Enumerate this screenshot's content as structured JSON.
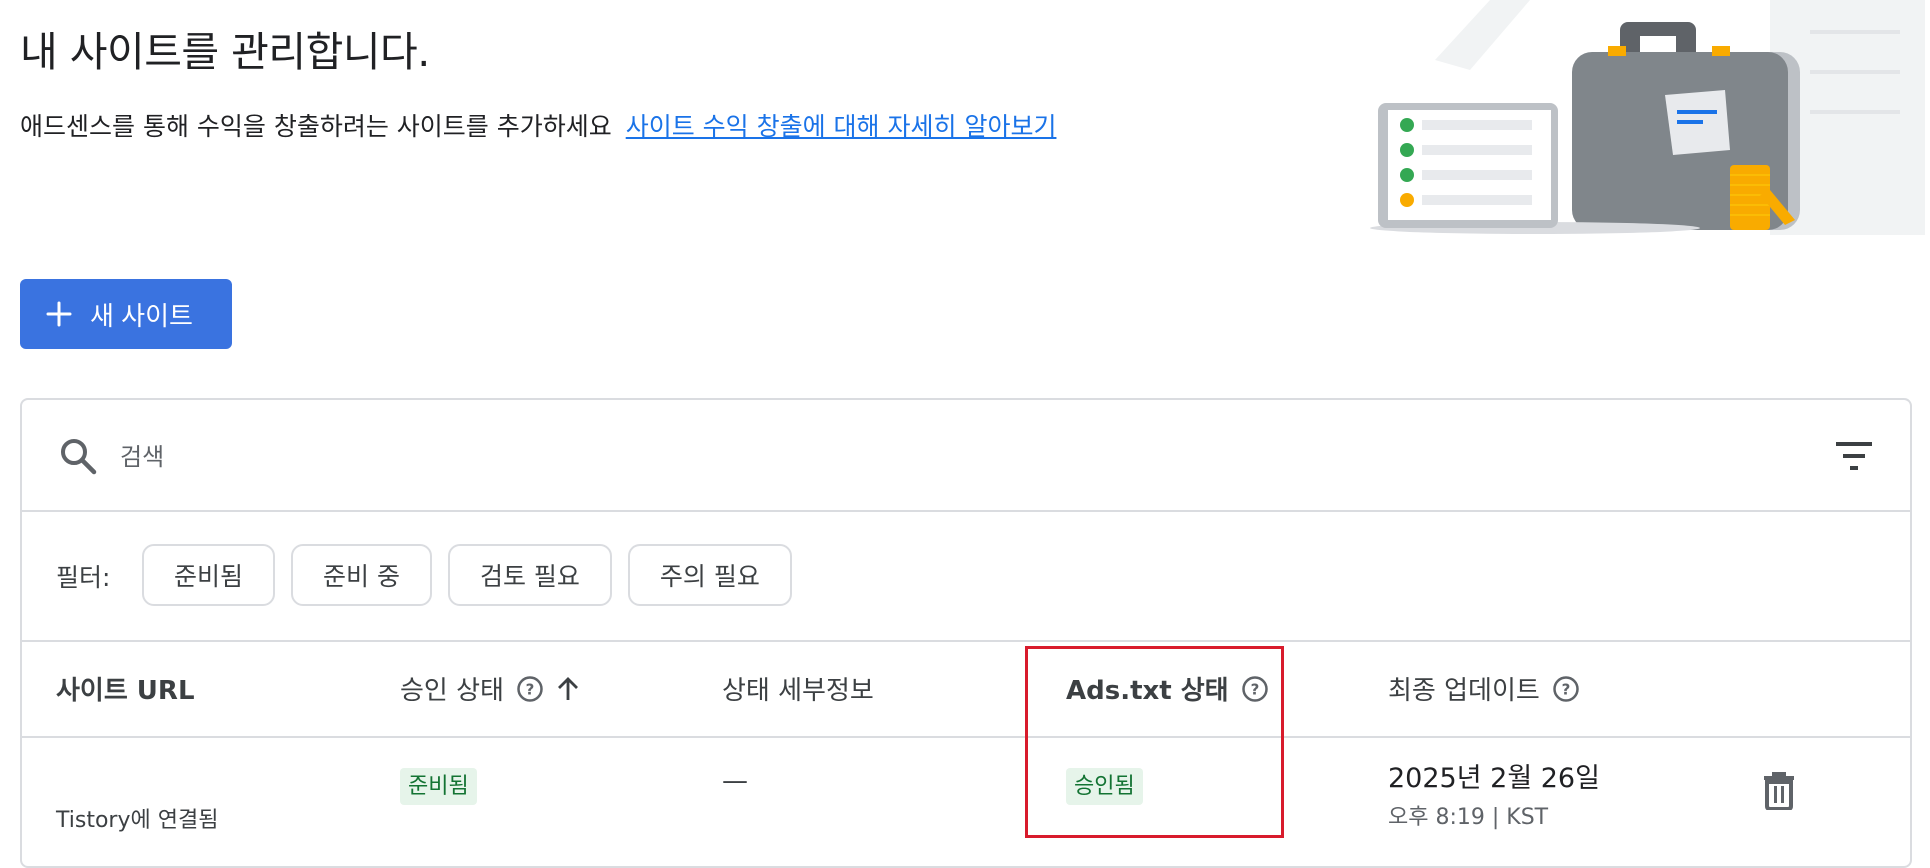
{
  "page": {
    "title": "내 사이트를 관리합니다.",
    "subtitle": "애드센스를 통해 수익을 창출하려는 사이트를 추가하세요",
    "learn_more_link": "사이트 수익 창출에 대해 자세히 알아보기"
  },
  "new_site_button": {
    "label": "새 사이트"
  },
  "search": {
    "placeholder": "검색",
    "value": ""
  },
  "filters": {
    "label": "필터:",
    "chips": [
      "준비됨",
      "준비 중",
      "검토 필요",
      "주의 필요"
    ]
  },
  "table": {
    "columns": {
      "site_url": "사이트 URL",
      "approval_status": "승인 상태",
      "status_details": "상태 세부정보",
      "ads_txt_status": "Ads.txt 상태",
      "last_updated": "최종 업데이트"
    },
    "rows": [
      {
        "site_url": "",
        "site_connection": "Tistory에 연결됨",
        "approval_status": "준비됨",
        "status_details": "—",
        "ads_txt_status": "승인됨",
        "last_updated_date": "2025년 2월 26일",
        "last_updated_time": "오후 8:19 | KST"
      }
    ]
  },
  "colors": {
    "primary_button": "#3a73e0",
    "link": "#1a73e8",
    "status_green_bg": "#e6f4ea",
    "status_green_text": "#137333",
    "highlight_red": "#d81b2c"
  },
  "icons": {
    "plus": "plus-icon",
    "search": "search-icon",
    "filter": "filter-icon",
    "help": "help-circle-icon",
    "sort": "arrow-up-icon",
    "delete": "trash-icon"
  }
}
